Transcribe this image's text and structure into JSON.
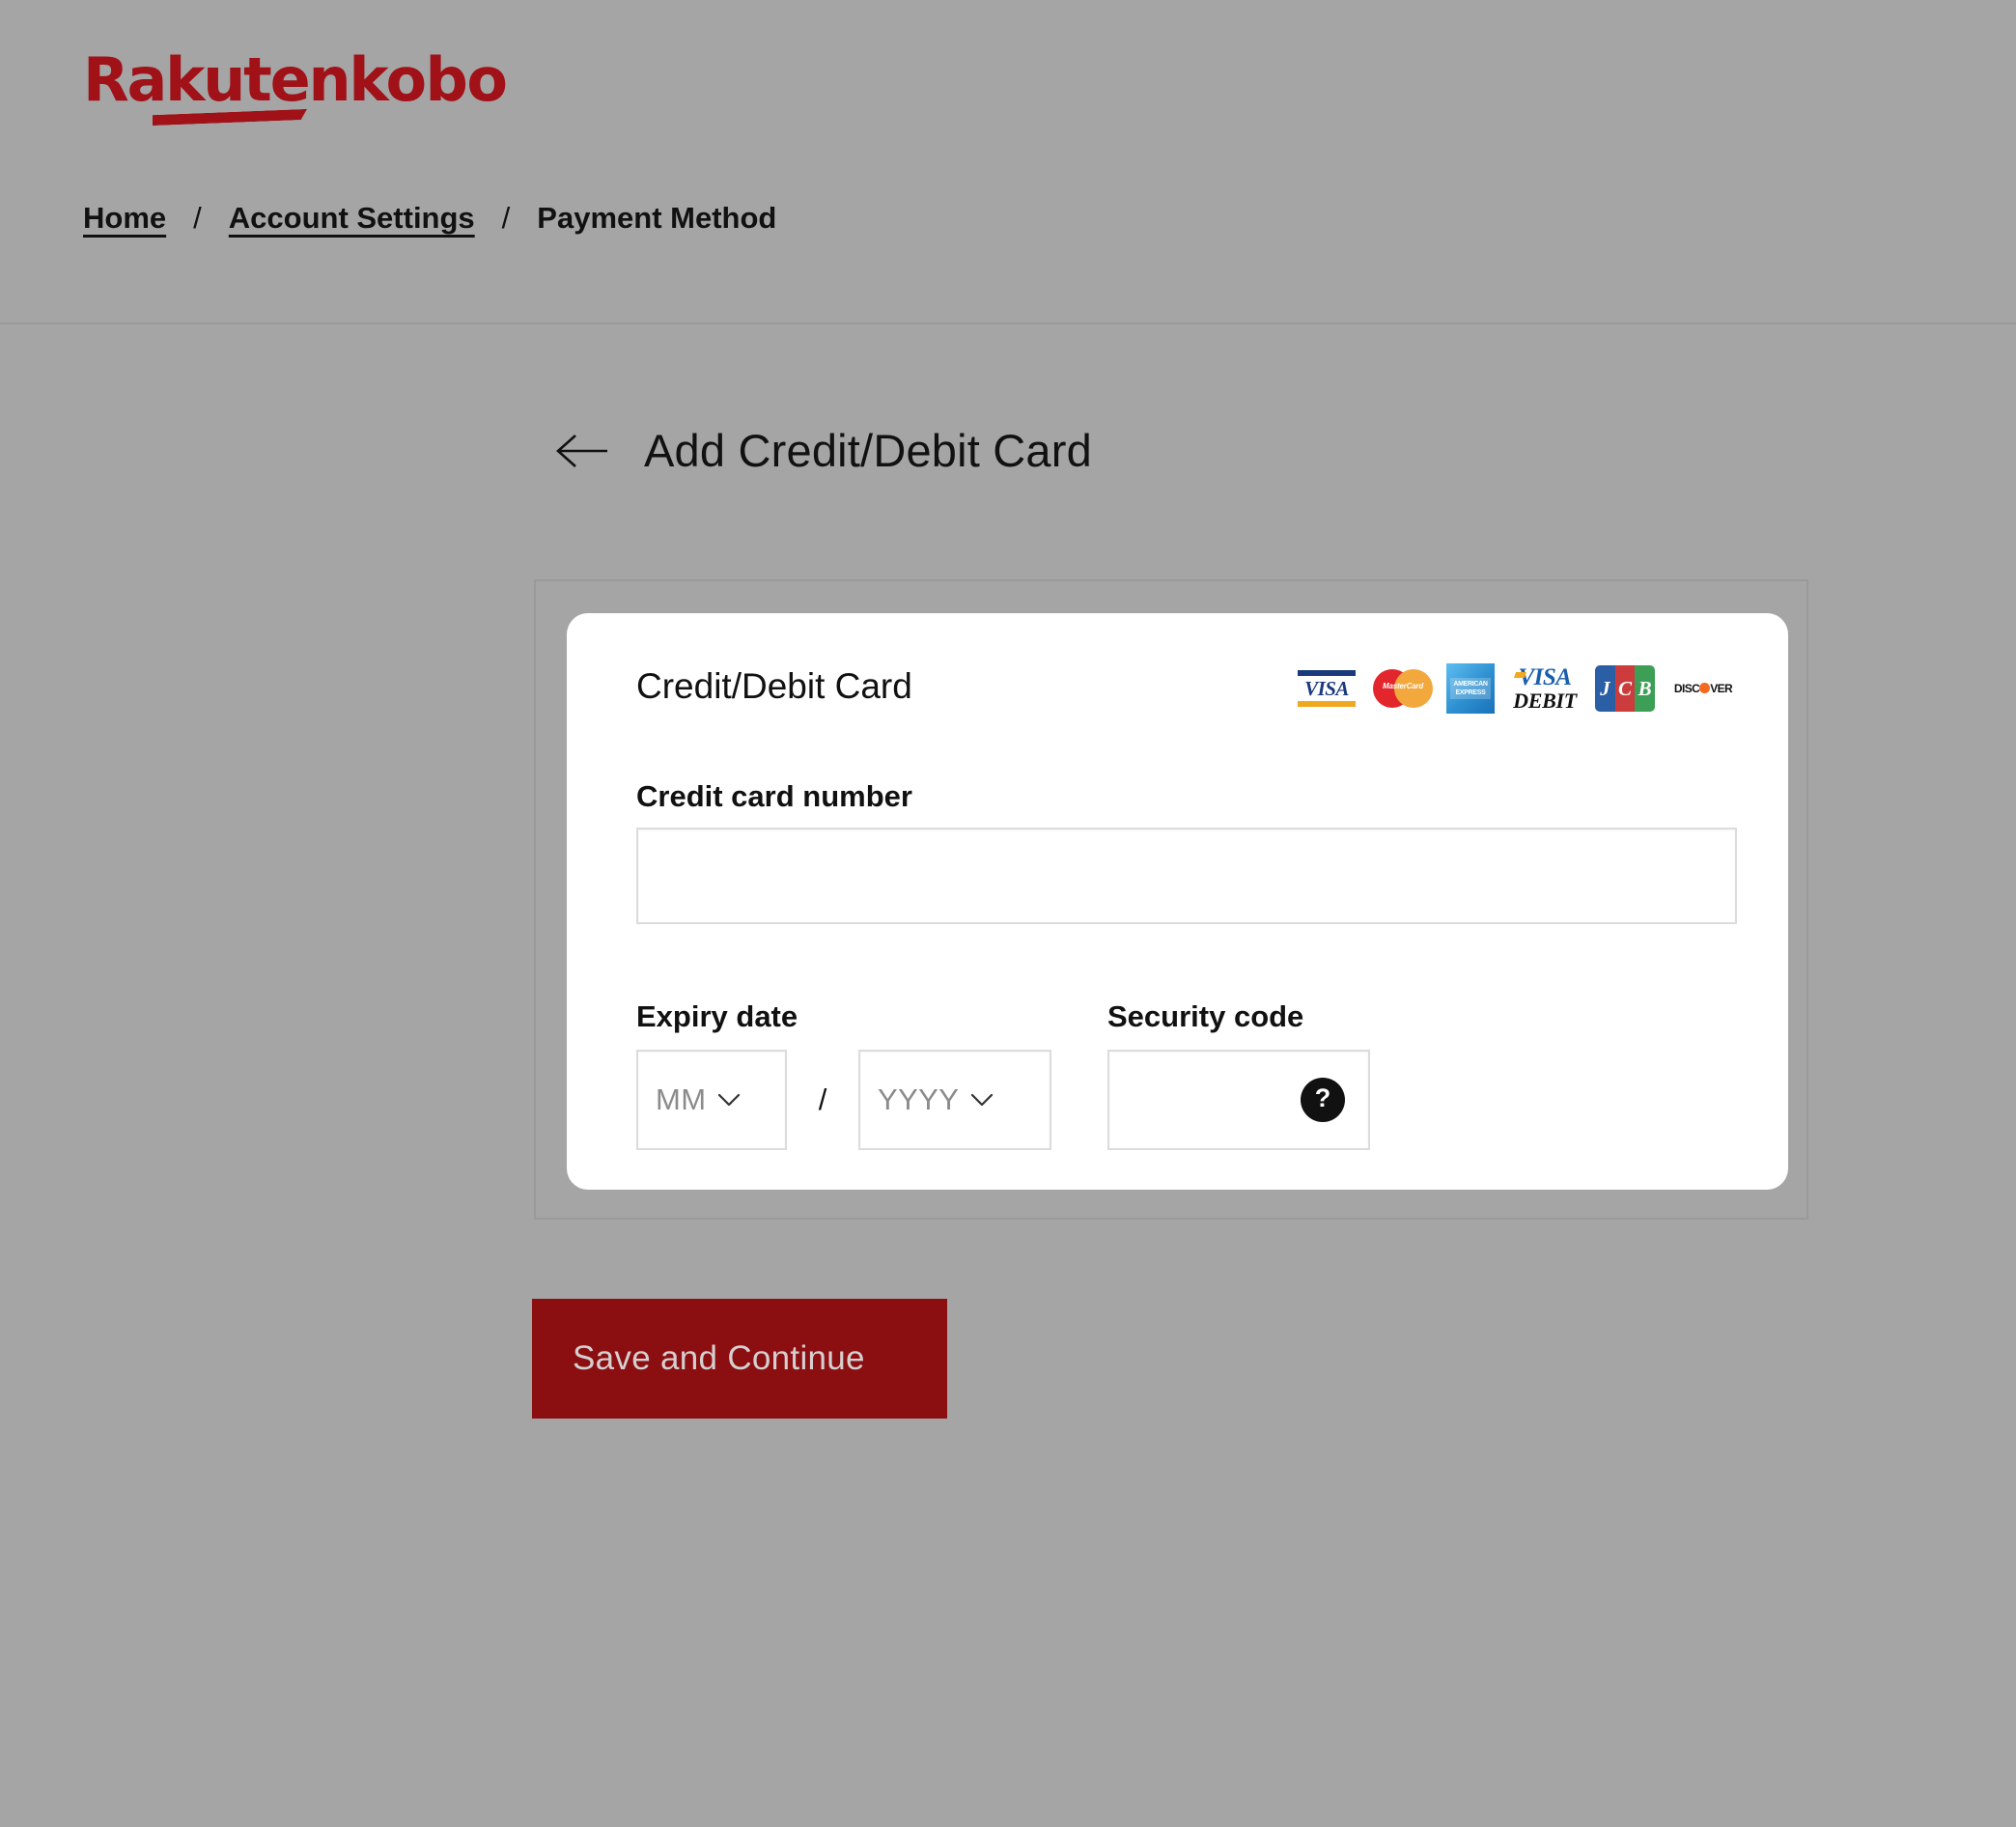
{
  "brand": {
    "logo_rakuten": "Rakuten",
    "logo_kobo": "kobo",
    "accent_red": "#a01118",
    "button_red": "#8b0e11",
    "page_background": "#a5a5a5"
  },
  "breadcrumb": {
    "items": [
      {
        "label": "Home",
        "is_link": true
      },
      {
        "label": "Account Settings",
        "is_link": true
      },
      {
        "label": "Payment Method",
        "is_link": false
      }
    ],
    "separator": "/"
  },
  "page": {
    "back_icon": "arrow-left-icon",
    "title": "Add Credit/Debit Card"
  },
  "card_form": {
    "heading": "Credit/Debit Card",
    "accepted_brands": [
      {
        "name": "visa",
        "label": "VISA"
      },
      {
        "name": "mastercard",
        "label": "MasterCard"
      },
      {
        "name": "american-express",
        "label": "AMERICAN EXPRESS"
      },
      {
        "name": "visa-debit",
        "label_top": "VISA",
        "label_bottom": "DEBIT"
      },
      {
        "name": "jcb",
        "letters": [
          "J",
          "C",
          "B"
        ]
      },
      {
        "name": "discover",
        "label_before": "DISC",
        "label_after": "VER"
      }
    ],
    "card_number": {
      "label": "Credit card number",
      "value": "",
      "placeholder": ""
    },
    "expiry": {
      "label": "Expiry date",
      "month": {
        "value": "MM",
        "placeholder": "MM"
      },
      "separator": "/",
      "year": {
        "value": "YYYY",
        "placeholder": "YYYY"
      }
    },
    "security_code": {
      "label": "Security code",
      "value": "",
      "placeholder": "",
      "help_glyph": "?"
    }
  },
  "actions": {
    "save_label": "Save and Continue"
  }
}
